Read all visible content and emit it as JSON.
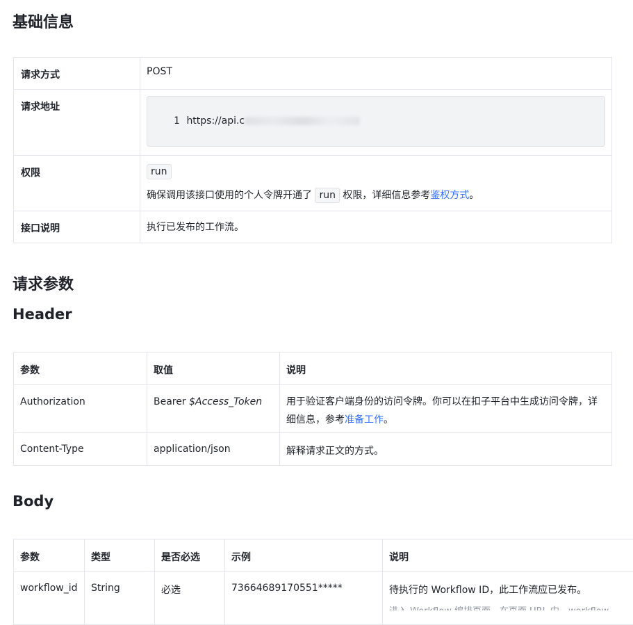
{
  "sections": {
    "basic_title": "基础信息",
    "request_params_title": "请求参数",
    "header_title": "Header",
    "body_title": "Body"
  },
  "basic": {
    "method_label": "请求方式",
    "method_value": "POST",
    "url_label": "请求地址",
    "url_line_no": "1",
    "url_visible": "https://api.c",
    "perm_label": "权限",
    "perm_tag": "run",
    "perm_text_before": "确保调用该接口使用的个人令牌开通了",
    "perm_text_tag": "run",
    "perm_text_after": "权限，详细信息参考",
    "perm_link": "鉴权方式",
    "perm_text_end": "。",
    "desc_label": "接口说明",
    "desc_value": "执行已发布的工作流。"
  },
  "header_table": {
    "columns": [
      "参数",
      "取值",
      "说明"
    ],
    "rows": [
      {
        "param": "Authorization",
        "value_prefix": "Bearer ",
        "value_italic": "$Access_Token",
        "desc": "用于验证客户端身份的访问令牌。你可以在扣子平台中生成访问令牌，详细信息，参考",
        "desc_link": "准备工作",
        "desc_end": "。"
      },
      {
        "param": "Content-Type",
        "value": "application/json",
        "desc": "解释请求正文的方式。"
      }
    ]
  },
  "body_table": {
    "columns": [
      "参数",
      "类型",
      "是否必选",
      "示例",
      "说明"
    ],
    "rows": [
      {
        "param": "workflow_id",
        "type": "String",
        "required": "必选",
        "example": "73664689170551*****",
        "desc": "待执行的 Workflow ID，此工作流应已发布。",
        "desc_more": "进入 Workflow 编排页面，在页面 URL 中，workflow"
      }
    ]
  }
}
